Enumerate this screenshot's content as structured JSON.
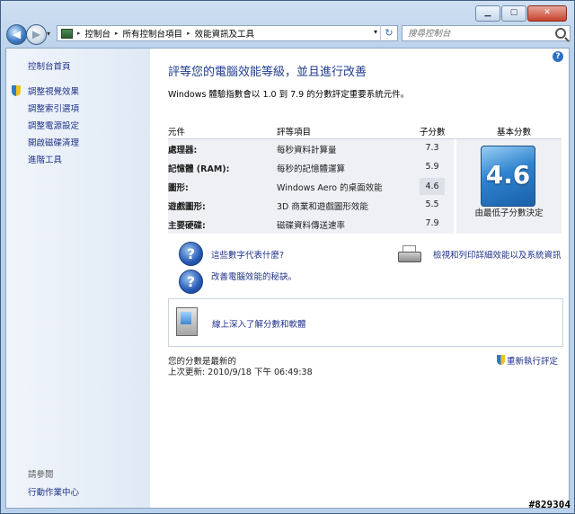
{
  "window": {
    "min_label": "▁",
    "max_label": "▢",
    "close_label": "✕"
  },
  "nav": {
    "back_label": "◀",
    "forward_label": "▶",
    "history_drop": "▾",
    "breadcrumbs": [
      "控制台",
      "所有控制台項目",
      "效能資訊及工具"
    ],
    "breadcrumb_sep": "▸",
    "address_drop": "▾",
    "refresh_label": "↻",
    "search_placeholder": "搜尋控制台"
  },
  "sidebar": {
    "home": "控制台首頁",
    "items": [
      "調整視覺效果",
      "調整索引選項",
      "調整電源設定",
      "開啟磁碟清理",
      "進階工具"
    ],
    "see_also_heading": "請參閱",
    "see_also_items": [
      "行動作業中心"
    ]
  },
  "main": {
    "help_label": "?",
    "title": "評等您的電腦效能等級，並且進行改善",
    "description": "Windows 體驗指數會以 1.0 到 7.9 的分數評定重要系統元件。",
    "table": {
      "headers": {
        "component": "元件",
        "rated": "評等項目",
        "subscore": "子分數",
        "base": "基本分數"
      },
      "rows": [
        {
          "component": "處理器:",
          "rated": "每秒資料計算量",
          "subscore": "7.3"
        },
        {
          "component": "記憶體 (RAM):",
          "rated": "每秒的記憶體運算",
          "subscore": "5.9"
        },
        {
          "component": "圖形:",
          "rated": "Windows Aero 的桌面效能",
          "subscore": "4.6"
        },
        {
          "component": "遊戲圖形:",
          "rated": "3D 商業和遊戲圖形效能",
          "subscore": "5.5"
        },
        {
          "component": "主要硬碟:",
          "rated": "磁碟資料傳送速率",
          "subscore": "7.9"
        }
      ],
      "base_score": "4.6",
      "base_caption": "由最低子分數決定"
    },
    "links": {
      "what_mean": "這些數字代表什麼?",
      "improve": "改善電腦效能的秘訣。",
      "print": "檢視和列印詳細效能以及系統資訊",
      "learn_more": "線上深入了解分數和軟體"
    },
    "status": {
      "current": "您的分數是最新的",
      "last_update": "上次更新: 2010/9/18 下午 06:49:38",
      "rerun": "重新執行評定"
    }
  },
  "watermark": "#829304"
}
